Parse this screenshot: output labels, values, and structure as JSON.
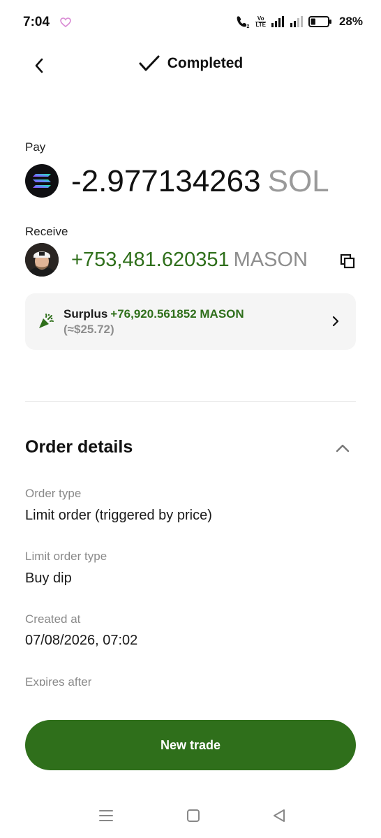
{
  "status_bar": {
    "time": "7:04",
    "battery_percent": "28%",
    "volte_top": "Vo",
    "volte_bottom": "LTE",
    "battery_level": 0.28
  },
  "header": {
    "title": "Completed"
  },
  "pay": {
    "label": "Pay",
    "amount": "-2.977134263",
    "symbol": "SOL",
    "coin_icon": "solana-logo-icon"
  },
  "receive": {
    "label": "Receive",
    "amount": "+753,481.620351",
    "symbol": "MASON",
    "coin_icon": "mason-avatar",
    "copy_icon": "copy-icon"
  },
  "surplus": {
    "label": "Surplus",
    "value": "+76,920.561852 MASON",
    "usd": "(≈$25.72)"
  },
  "order_details": {
    "title": "Order details",
    "fields": [
      {
        "label": "Order type",
        "value": "Limit order (triggered by price)"
      },
      {
        "label": "Limit order type",
        "value": "Buy dip"
      },
      {
        "label": "Created at",
        "value": "07/08/2026, 07:02"
      },
      {
        "label": "Expires after",
        "value": ""
      }
    ]
  },
  "actions": {
    "new_trade": "New trade"
  },
  "colors": {
    "accent_green": "#2f6f1b",
    "muted": "#8e8e8e"
  }
}
